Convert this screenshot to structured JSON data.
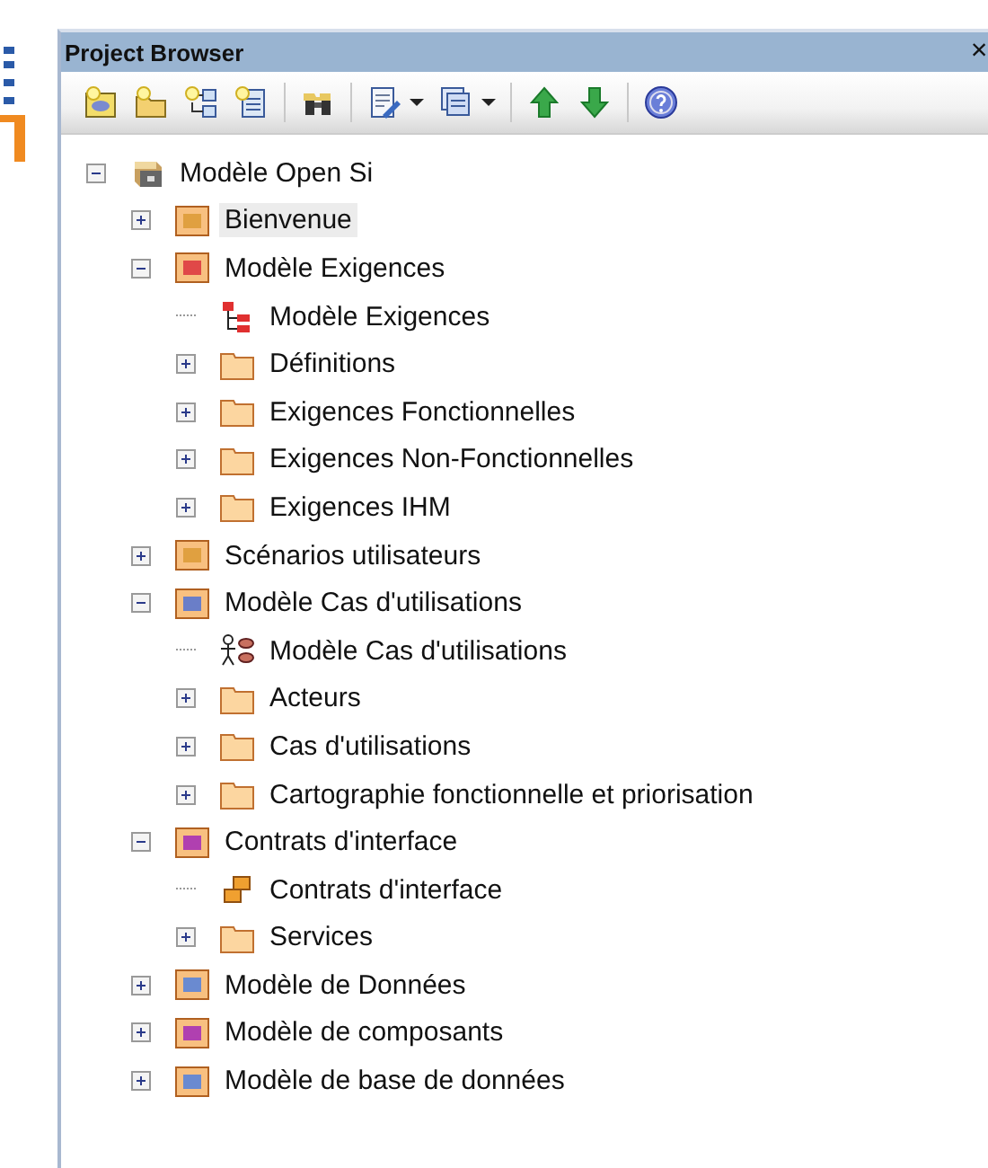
{
  "panel": {
    "title": "Project Browser",
    "close": "×"
  },
  "tree": [
    {
      "label": "Modèle Open Si",
      "kind": "model",
      "expanded": true,
      "selected": false,
      "children": [
        {
          "label": "Bienvenue",
          "kind": "view",
          "expanded": false,
          "selected": true
        },
        {
          "label": "Modèle Exigences",
          "kind": "requirements",
          "expanded": true,
          "selected": false,
          "children": [
            {
              "label": "Modèle Exigences",
              "kind": "diagram-tree",
              "selected": false
            },
            {
              "label": "Définitions",
              "kind": "folder",
              "expanded": false,
              "selected": false
            },
            {
              "label": "Exigences Fonctionnelles",
              "kind": "folder",
              "expanded": false,
              "selected": false
            },
            {
              "label": "Exigences Non-Fonctionnelles",
              "kind": "folder",
              "expanded": false,
              "selected": false
            },
            {
              "label": "Exigences IHM",
              "kind": "folder",
              "expanded": false,
              "selected": false
            }
          ]
        },
        {
          "label": "Scénarios utilisateurs",
          "kind": "view",
          "expanded": false,
          "selected": false
        },
        {
          "label": "Modèle Cas d'utilisations",
          "kind": "usecase",
          "expanded": true,
          "selected": false,
          "children": [
            {
              "label": "Modèle Cas d'utilisations",
              "kind": "diagram-usecase",
              "selected": false
            },
            {
              "label": "Acteurs",
              "kind": "folder",
              "expanded": false,
              "selected": false
            },
            {
              "label": "Cas d'utilisations",
              "kind": "folder",
              "expanded": false,
              "selected": false
            },
            {
              "label": "Cartographie fonctionnelle et priorisation",
              "kind": "folder",
              "expanded": false,
              "selected": false
            }
          ]
        },
        {
          "label": "Contrats d'interface",
          "kind": "component",
          "expanded": true,
          "selected": false,
          "children": [
            {
              "label": "Contrats d'interface",
              "kind": "diagram-component",
              "selected": false
            },
            {
              "label": "Services",
              "kind": "folder",
              "expanded": false,
              "selected": false
            }
          ]
        },
        {
          "label": "Modèle de Données",
          "kind": "class",
          "expanded": false,
          "selected": false
        },
        {
          "label": "Modèle de composants",
          "kind": "component",
          "expanded": false,
          "selected": false
        },
        {
          "label": "Modèle de base de données",
          "kind": "class",
          "expanded": false,
          "selected": false
        }
      ]
    }
  ]
}
